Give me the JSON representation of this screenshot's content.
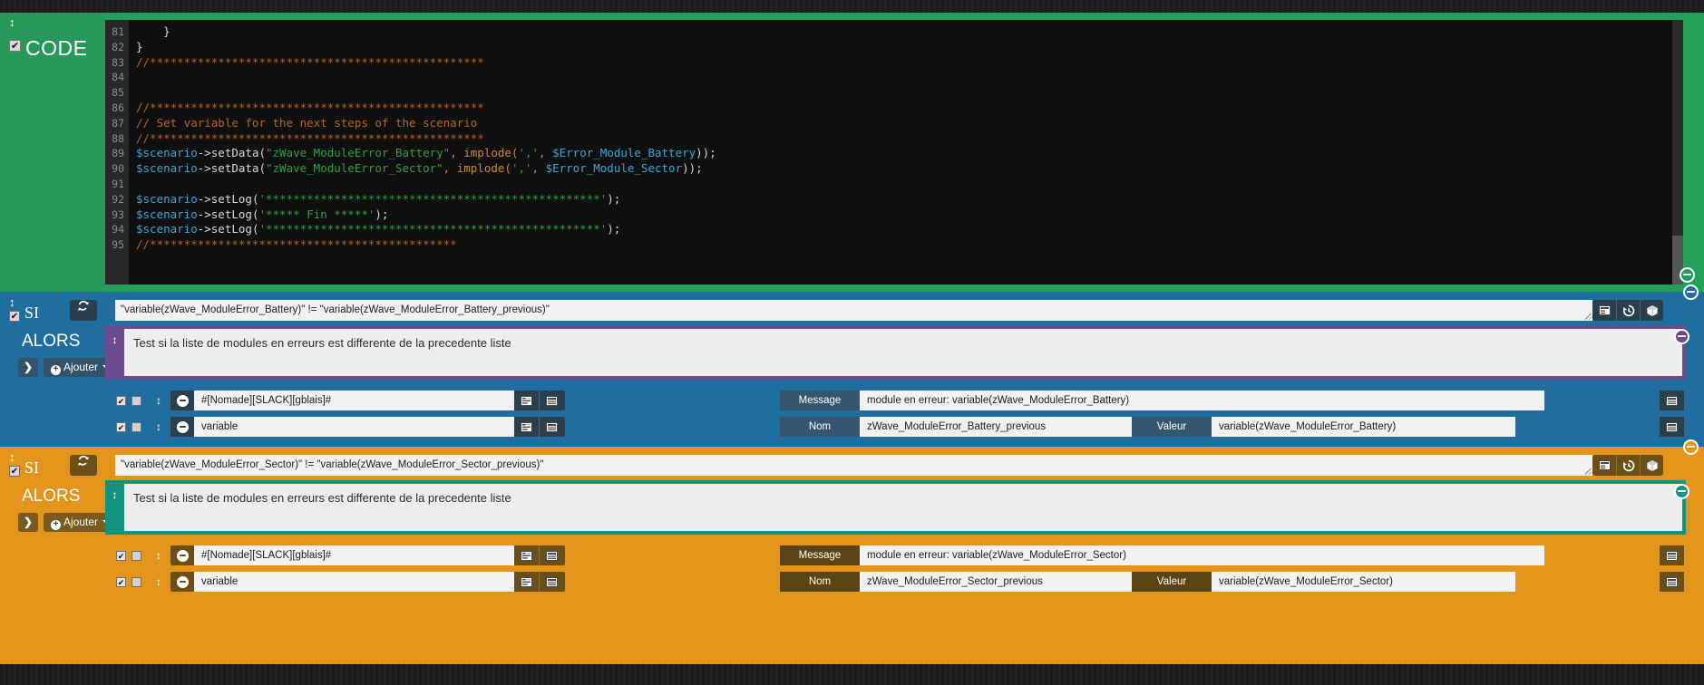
{
  "colors": {
    "code_green": "#22a05a",
    "code_green_dark": "#269958",
    "si_blue": "#206ea0",
    "si_blue_dark": "#2a3f4d",
    "si_orange": "#e2941b",
    "si_orange_dark": "#6b4f16",
    "comment_purple": "#6b4c8f",
    "comment_teal": "#12937e",
    "editor_bg": "#0f0f0f",
    "gutter_bg": "#282828"
  },
  "code_block": {
    "title": "CODE",
    "checkbox_checked": true,
    "drag_handle_icon": "updown-arrow-icon",
    "collapse_icon": "minus-circle-icon",
    "lines": [
      {
        "no": "81",
        "segments": [
          {
            "t": "    }",
            "c": "pl"
          }
        ]
      },
      {
        "no": "82",
        "segments": [
          {
            "t": "}",
            "c": "pl"
          }
        ]
      },
      {
        "no": "83",
        "segments": [
          {
            "t": "//*************************************************",
            "c": "com"
          }
        ]
      },
      {
        "no": "84",
        "segments": [
          {
            "t": "",
            "c": "pl"
          }
        ]
      },
      {
        "no": "85",
        "segments": [
          {
            "t": "",
            "c": "pl"
          }
        ]
      },
      {
        "no": "86",
        "segments": [
          {
            "t": "//*************************************************",
            "c": "com"
          }
        ]
      },
      {
        "no": "87",
        "segments": [
          {
            "t": "// Set variable for the next steps of the scenario",
            "c": "com"
          }
        ]
      },
      {
        "no": "88",
        "segments": [
          {
            "t": "//*************************************************",
            "c": "com"
          }
        ]
      },
      {
        "no": "89",
        "segments": [
          {
            "t": "$scenario",
            "c": "var"
          },
          {
            "t": "->setData(",
            "c": "pl"
          },
          {
            "t": "\"zWave_ModuleError_Battery\"",
            "c": "str"
          },
          {
            "t": ", implode(",
            "c": "or"
          },
          {
            "t": "','",
            "c": "str"
          },
          {
            "t": ", ",
            "c": "or"
          },
          {
            "t": "$Error_Module_Battery",
            "c": "var"
          },
          {
            "t": "));",
            "c": "pl"
          }
        ]
      },
      {
        "no": "90",
        "segments": [
          {
            "t": "$scenario",
            "c": "var"
          },
          {
            "t": "->setData(",
            "c": "pl"
          },
          {
            "t": "\"zWave_ModuleError_Sector\"",
            "c": "str"
          },
          {
            "t": ", implode(",
            "c": "or"
          },
          {
            "t": "','",
            "c": "str"
          },
          {
            "t": ", ",
            "c": "or"
          },
          {
            "t": "$Error_Module_Sector",
            "c": "var"
          },
          {
            "t": "));",
            "c": "pl"
          }
        ]
      },
      {
        "no": "91",
        "segments": [
          {
            "t": "",
            "c": "pl"
          }
        ]
      },
      {
        "no": "92",
        "segments": [
          {
            "t": "$scenario",
            "c": "var"
          },
          {
            "t": "->setLog(",
            "c": "pl"
          },
          {
            "t": "'*************************************************'",
            "c": "str"
          },
          {
            "t": ");",
            "c": "pl"
          }
        ]
      },
      {
        "no": "93",
        "segments": [
          {
            "t": "$scenario",
            "c": "var"
          },
          {
            "t": "->setLog(",
            "c": "pl"
          },
          {
            "t": "'***** Fin *****'",
            "c": "str"
          },
          {
            "t": ");",
            "c": "pl"
          }
        ]
      },
      {
        "no": "94",
        "segments": [
          {
            "t": "$scenario",
            "c": "var"
          },
          {
            "t": "->setLog(",
            "c": "pl"
          },
          {
            "t": "'*************************************************'",
            "c": "str"
          },
          {
            "t": ");",
            "c": "pl"
          }
        ]
      },
      {
        "no": "95",
        "segments": [
          {
            "t": "//*********************************************",
            "c": "com"
          }
        ]
      }
    ]
  },
  "blocks": [
    {
      "id": "battery",
      "si_label": "SI",
      "alors_label": "ALORS",
      "checkbox_checked": true,
      "refresh_icon": "refresh-icon",
      "condition": "\"variable(zWave_ModuleError_Battery)\" != \"variable(zWave_ModuleError_Battery_previous)\"",
      "cond_icons": [
        "list-icon",
        "history-icon",
        "box-icon"
      ],
      "collapse_icon": "minus-circle-icon",
      "expand_icon": "chevron-right-icon",
      "add_label": "Ajouter",
      "comment": "Test si la liste de modules en erreurs est differente de la precedente liste",
      "comment_handle_icon": "updown-arrow-icon",
      "actions": [
        {
          "checked": true,
          "second_checked": false,
          "drag_icon": "updown-arrow-icon",
          "remove_icon": "minus-circle-icon",
          "command": "#[Nomade][SLACK][gblais]#",
          "cmd_icons": [
            "select-list-icon",
            "window-icon"
          ],
          "fields": [
            {
              "label": "Message",
              "value": "module en erreur: variable(zWave_ModuleError_Battery)"
            }
          ],
          "trailing_icon": "window-icon"
        },
        {
          "checked": true,
          "second_checked": false,
          "drag_icon": "updown-arrow-icon",
          "remove_icon": "minus-circle-icon",
          "command": "variable",
          "cmd_icons": [
            "select-list-icon",
            "window-icon"
          ],
          "fields": [
            {
              "label": "Nom",
              "value": "zWave_ModuleError_Battery_previous"
            },
            {
              "label": "Valeur",
              "value": "variable(zWave_ModuleError_Battery)"
            }
          ],
          "trailing_icon": "window-icon"
        }
      ]
    },
    {
      "id": "sector",
      "si_label": "SI",
      "alors_label": "ALORS",
      "checkbox_checked": true,
      "refresh_icon": "refresh-icon",
      "condition": "\"variable(zWave_ModuleError_Sector)\" != \"variable(zWave_ModuleError_Sector_previous)\"",
      "cond_icons": [
        "list-icon",
        "history-icon",
        "box-icon"
      ],
      "collapse_icon": "minus-circle-icon",
      "expand_icon": "chevron-right-icon",
      "add_label": "Ajouter",
      "comment": "Test si la liste de modules en erreurs est differente de la precedente liste",
      "comment_handle_icon": "updown-arrow-icon",
      "actions": [
        {
          "checked": true,
          "second_checked": false,
          "drag_icon": "updown-arrow-icon",
          "remove_icon": "minus-circle-icon",
          "command": "#[Nomade][SLACK][gblais]#",
          "cmd_icons": [
            "select-list-icon",
            "window-icon"
          ],
          "fields": [
            {
              "label": "Message",
              "value": "module en erreur: variable(zWave_ModuleError_Sector)"
            }
          ],
          "trailing_icon": "window-icon"
        },
        {
          "checked": true,
          "second_checked": false,
          "drag_icon": "updown-arrow-icon",
          "remove_icon": "minus-circle-icon",
          "command": "variable",
          "cmd_icons": [
            "select-list-icon",
            "window-icon"
          ],
          "fields": [
            {
              "label": "Nom",
              "value": "zWave_ModuleError_Sector_previous"
            },
            {
              "label": "Valeur",
              "value": "variable(zWave_ModuleError_Sector)"
            }
          ],
          "trailing_icon": "window-icon"
        }
      ]
    }
  ]
}
